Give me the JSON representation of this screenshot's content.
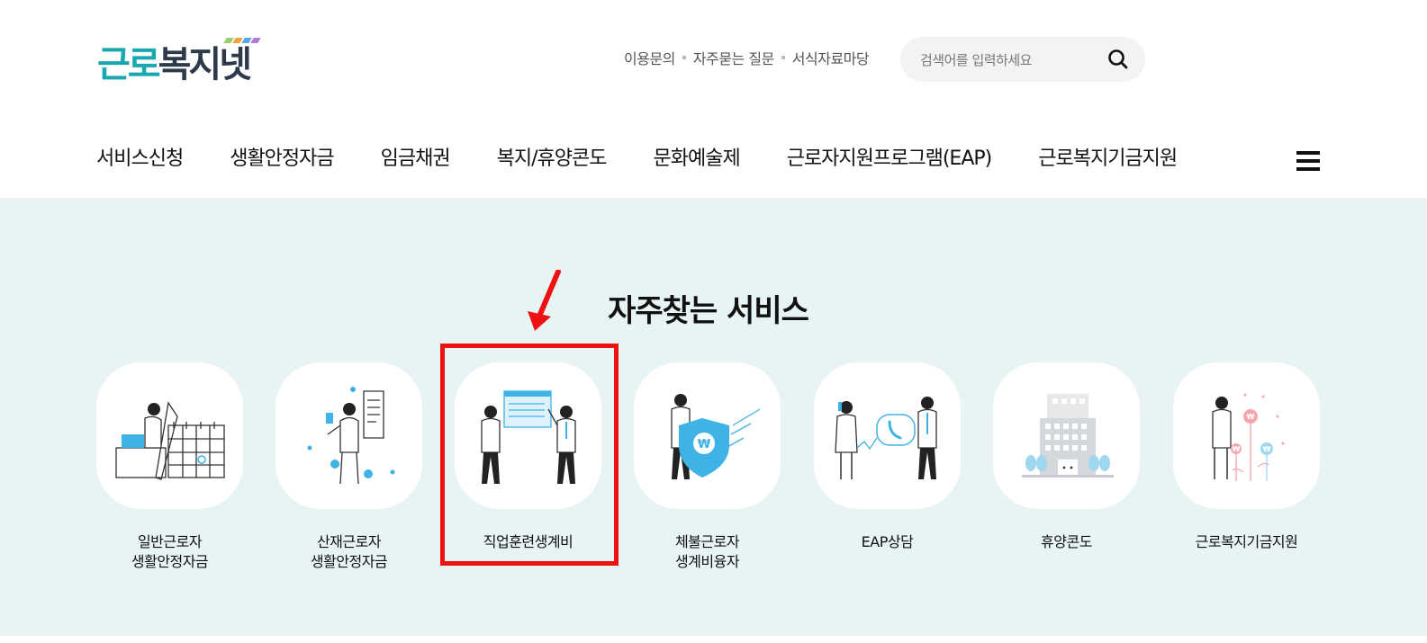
{
  "logo": {
    "text_part1": "근로",
    "text_part2": "복지넷"
  },
  "util_links": [
    "이용문의",
    "자주묻는 질문",
    "서식자료마당"
  ],
  "search": {
    "placeholder": "검색어를 입력하세요"
  },
  "gnb": [
    "서비스신청",
    "생활안정자금",
    "임금채권",
    "복지/휴양콘도",
    "문화예술제",
    "근로자지원프로그램(EAP)",
    "근로복지기금지원"
  ],
  "main": {
    "title": "자주찾는 서비스",
    "cards": [
      {
        "line1": "일반근로자",
        "line2": "생활안정자금"
      },
      {
        "line1": "산재근로자",
        "line2": "생활안정자금"
      },
      {
        "line1": "직업훈련생계비",
        "line2": ""
      },
      {
        "line1": "체불근로자",
        "line2": "생계비융자"
      },
      {
        "line1": "EAP상담",
        "line2": ""
      },
      {
        "line1": "휴양콘도",
        "line2": ""
      },
      {
        "line1": "근로복지기금지원",
        "line2": ""
      }
    ]
  },
  "colors": {
    "accent": "#1aa8b0",
    "background": "#e8f4f4",
    "highlight": "#ee1111",
    "icon_blue": "#3fb3e6"
  }
}
